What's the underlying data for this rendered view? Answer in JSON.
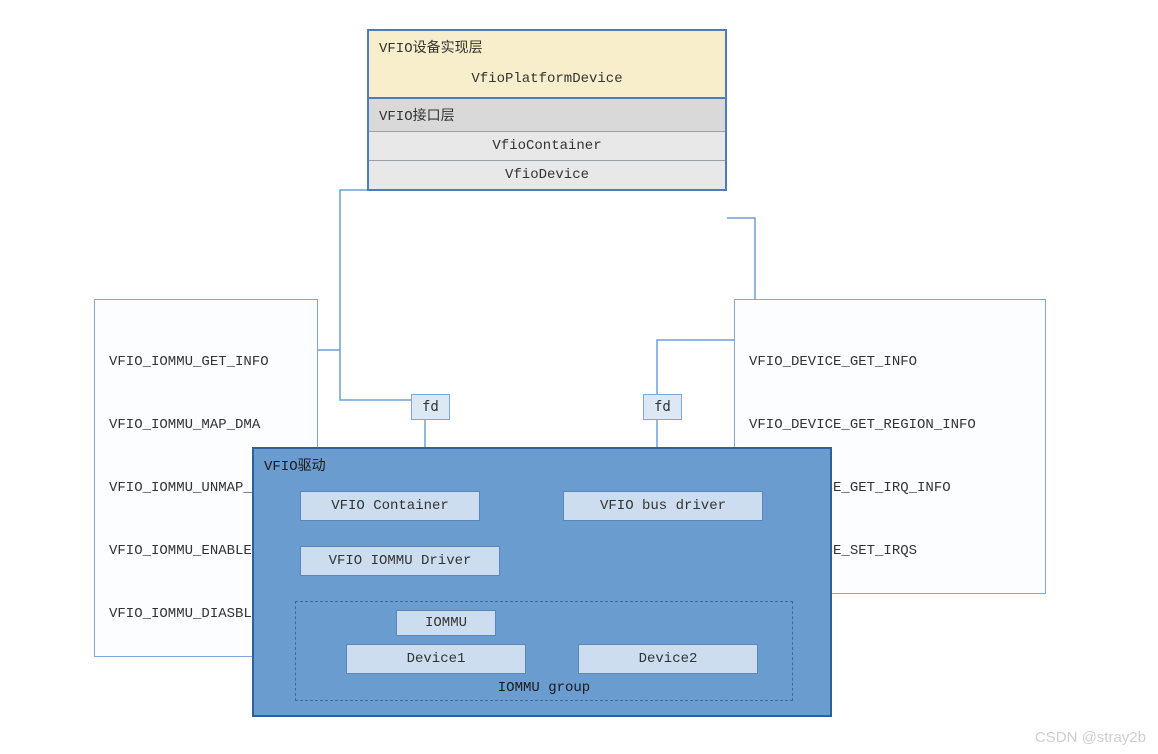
{
  "top": {
    "dev_layer_title": "VFIO设备实现层",
    "dev_layer_item": "VfioPlatformDevice",
    "if_layer_title": "VFIO接口层",
    "if_items": [
      "VfioContainer",
      "VfioDevice"
    ]
  },
  "api_left": [
    "VFIO_IOMMU_GET_INFO",
    "VFIO_IOMMU_MAP_DMA",
    "VFIO_IOMMU_UNMAP_DAM",
    "VFIO_IOMMU_ENABLE",
    "VFIO_IOMMU_DIASBLE"
  ],
  "api_right": [
    "VFIO_DEVICE_GET_INFO",
    "VFIO_DEVICE_GET_REGION_INFO",
    "VFIO_DEVICE_GET_IRQ_INFO",
    "VFIO_DEVICE_SET_IRQS"
  ],
  "fd_label": "fd",
  "driver": {
    "title": "VFIO驱动",
    "container": "VFIO Container",
    "bus_driver": "VFIO bus driver",
    "iommu_driver": "VFIO IOMMU Driver",
    "iommu": "IOMMU",
    "device1": "Device1",
    "device2": "Device2",
    "group": "IOMMU group"
  },
  "watermark": "CSDN @stray2b"
}
